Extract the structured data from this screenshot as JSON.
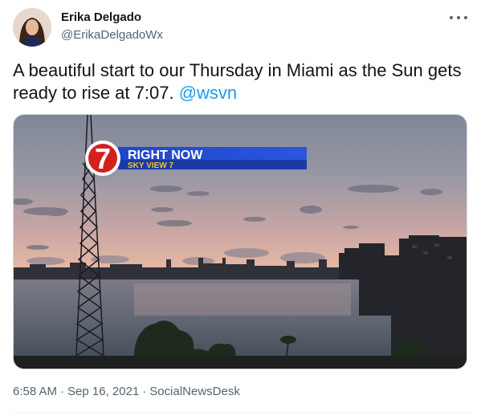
{
  "author": {
    "display_name": "Erika Delgado",
    "handle": "@ErikaDelgadoWx"
  },
  "tweet": {
    "text": "A beautiful start to our Thursday in Miami as the Sun gets ready to rise at 7:07.",
    "mention": "@wsvn"
  },
  "media": {
    "overlay_logo_number": "7",
    "overlay_title": "RIGHT NOW",
    "overlay_subtitle": "SKY VIEW 7"
  },
  "meta": {
    "time": "6:58 AM",
    "separator": "·",
    "date": "Sep 16, 2021",
    "source": "SocialNewsDesk"
  },
  "colors": {
    "link": "#1d9bf0",
    "secondary_text": "#536471",
    "overlay_banner": "#1f47c9",
    "overlay_subtitle": "#f2c420"
  },
  "icons": {
    "more": "more-horizontal-icon"
  }
}
